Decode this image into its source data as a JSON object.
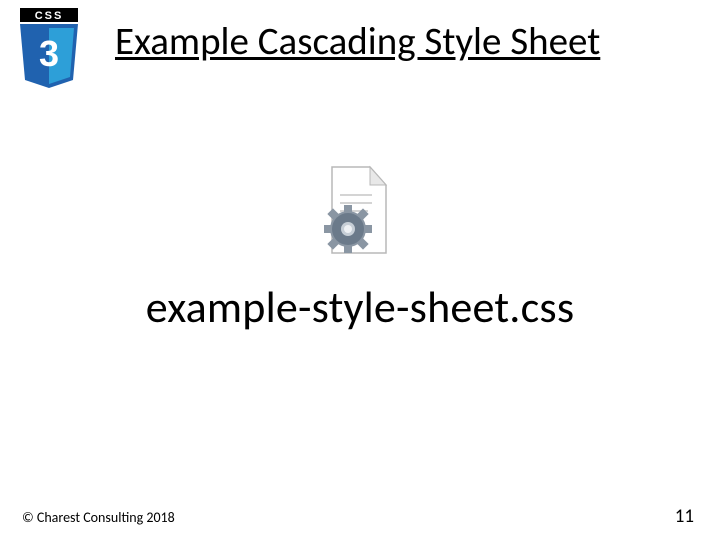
{
  "header": {
    "title": "Example Cascading Style Sheet",
    "logo_label": "CSS",
    "logo_number": "3"
  },
  "file": {
    "name": "example-style-sheet.css"
  },
  "footer": {
    "copyright": "© Charest Consulting 2018",
    "page_number": "11"
  },
  "colors": {
    "shield_top": "#2062af",
    "shield_right": "#2d9fd8",
    "gear": "#6b7a8a"
  }
}
